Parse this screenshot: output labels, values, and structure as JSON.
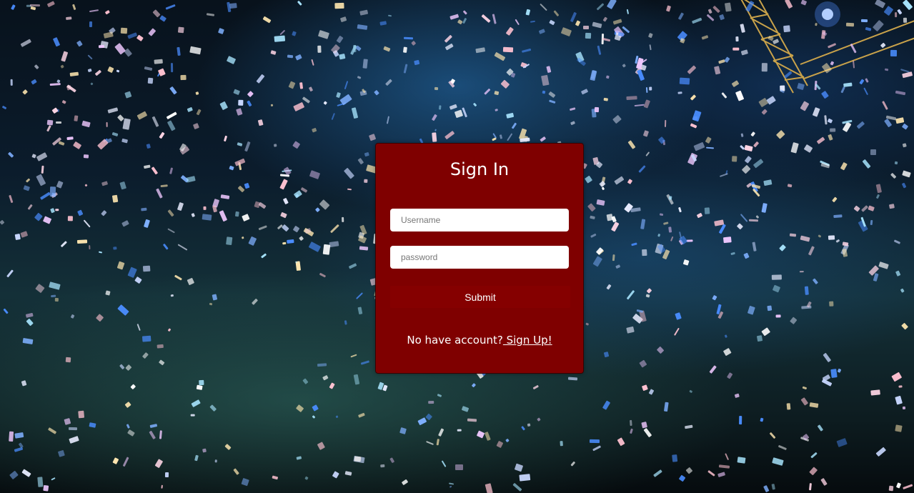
{
  "background": {
    "description_colors": {
      "sky_dark": "#08121c",
      "sky_blue": "#2878be",
      "haze_teal": "#326e64"
    }
  },
  "card": {
    "title": "Sign In",
    "background_color": "#7f0000",
    "username": {
      "value": "",
      "placeholder": "Username"
    },
    "password": {
      "value": "",
      "placeholder": "password"
    },
    "submit_label": "Submit",
    "signup_prompt": "No have account?",
    "signup_link": " Sign Up!"
  }
}
